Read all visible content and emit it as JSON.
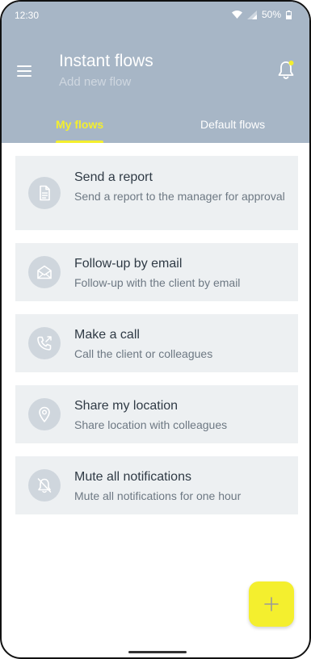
{
  "status": {
    "time": "12:30",
    "battery": "50%"
  },
  "header": {
    "title": "Instant flows",
    "subtitle": "Add new flow"
  },
  "tabs": [
    {
      "label": "My flows",
      "active": true
    },
    {
      "label": "Default flows",
      "active": false
    }
  ],
  "flows": [
    {
      "title": "Send a report",
      "description": "Send a report to the manager for approval",
      "icon": "document-icon"
    },
    {
      "title": "Follow-up by email",
      "description": "Follow-up with the client by email",
      "icon": "envelope-icon"
    },
    {
      "title": "Make a call",
      "description": "Call the client or colleagues",
      "icon": "phone-icon"
    },
    {
      "title": "Share my location",
      "description": "Share location with colleagues",
      "icon": "location-pin-icon"
    },
    {
      "title": "Mute all notifications",
      "description": "Mute all notifications for one hour",
      "icon": "bell-off-icon"
    }
  ],
  "colors": {
    "header": "#a7b6c6",
    "accent": "#f4ef2e",
    "card": "#edf0f2",
    "iconCircle": "#cfd6dd"
  }
}
